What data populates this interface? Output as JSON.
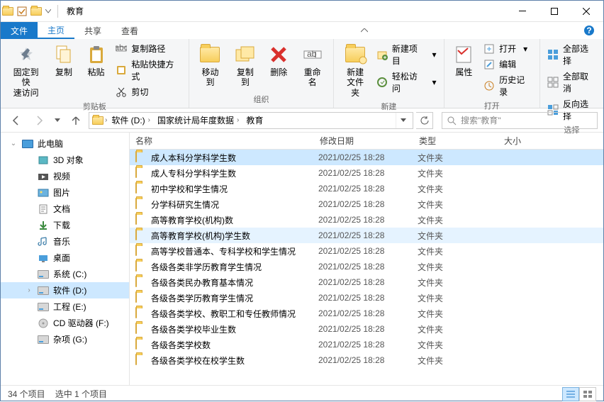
{
  "title": "教育",
  "menutabs": {
    "file": "文件",
    "home": "主页",
    "share": "共享",
    "view": "查看"
  },
  "ribbon": {
    "clipboard": {
      "label": "剪贴板",
      "pin": "固定到快\n速访问",
      "copy": "复制",
      "paste": "粘贴",
      "copypath": "复制路径",
      "pasteshortcut": "粘贴快捷方式",
      "cut": "剪切"
    },
    "organize": {
      "label": "组织",
      "moveto": "移动到",
      "copyto": "复制到",
      "delete": "删除",
      "rename": "重命名"
    },
    "new": {
      "label": "新建",
      "newfolder": "新建\n文件夹",
      "newitem": "新建项目",
      "easyaccess": "轻松访问"
    },
    "open": {
      "label": "打开",
      "properties": "属性",
      "open": "打开",
      "edit": "编辑",
      "history": "历史记录"
    },
    "select": {
      "label": "选择",
      "selectall": "全部选择",
      "selectnone": "全部取消",
      "invert": "反向选择"
    }
  },
  "breadcrumb": [
    "软件 (D:)",
    "国家统计局年度数据",
    "教育"
  ],
  "search_placeholder": "搜索\"教育\"",
  "columns": {
    "name": "名称",
    "date": "修改日期",
    "type": "类型",
    "size": "大小"
  },
  "tree": {
    "thispc": "此电脑",
    "items": [
      "3D 对象",
      "视频",
      "图片",
      "文档",
      "下载",
      "音乐",
      "桌面",
      "系统 (C:)",
      "软件 (D:)",
      "工程 (E:)",
      "CD 驱动器 (F:)",
      "杂项 (G:)"
    ]
  },
  "files": [
    {
      "name": "成人本科分学科学生数",
      "date": "2021/02/25 18:28",
      "type": "文件夹",
      "state": "sel"
    },
    {
      "name": "成人专科分学科学生数",
      "date": "2021/02/25 18:28",
      "type": "文件夹",
      "state": ""
    },
    {
      "name": "初中学校和学生情况",
      "date": "2021/02/25 18:28",
      "type": "文件夹",
      "state": ""
    },
    {
      "name": "分学科研究生情况",
      "date": "2021/02/25 18:28",
      "type": "文件夹",
      "state": ""
    },
    {
      "name": "高等教育学校(机构)数",
      "date": "2021/02/25 18:28",
      "type": "文件夹",
      "state": ""
    },
    {
      "name": "高等教育学校(机构)学生数",
      "date": "2021/02/25 18:28",
      "type": "文件夹",
      "state": "hov"
    },
    {
      "name": "高等学校普通本、专科学校和学生情况",
      "date": "2021/02/25 18:28",
      "type": "文件夹",
      "state": ""
    },
    {
      "name": "各级各类非学历教育学生情况",
      "date": "2021/02/25 18:28",
      "type": "文件夹",
      "state": ""
    },
    {
      "name": "各级各类民办教育基本情况",
      "date": "2021/02/25 18:28",
      "type": "文件夹",
      "state": ""
    },
    {
      "name": "各级各类学历教育学生情况",
      "date": "2021/02/25 18:28",
      "type": "文件夹",
      "state": ""
    },
    {
      "name": "各级各类学校、教职工和专任教师情况",
      "date": "2021/02/25 18:28",
      "type": "文件夹",
      "state": ""
    },
    {
      "name": "各级各类学校毕业生数",
      "date": "2021/02/25 18:28",
      "type": "文件夹",
      "state": ""
    },
    {
      "name": "各级各类学校数",
      "date": "2021/02/25 18:28",
      "type": "文件夹",
      "state": ""
    },
    {
      "name": "各级各类学校在校学生数",
      "date": "2021/02/25 18:28",
      "type": "文件夹",
      "state": ""
    }
  ],
  "status": {
    "count": "34 个项目",
    "selection": "选中 1 个项目"
  }
}
